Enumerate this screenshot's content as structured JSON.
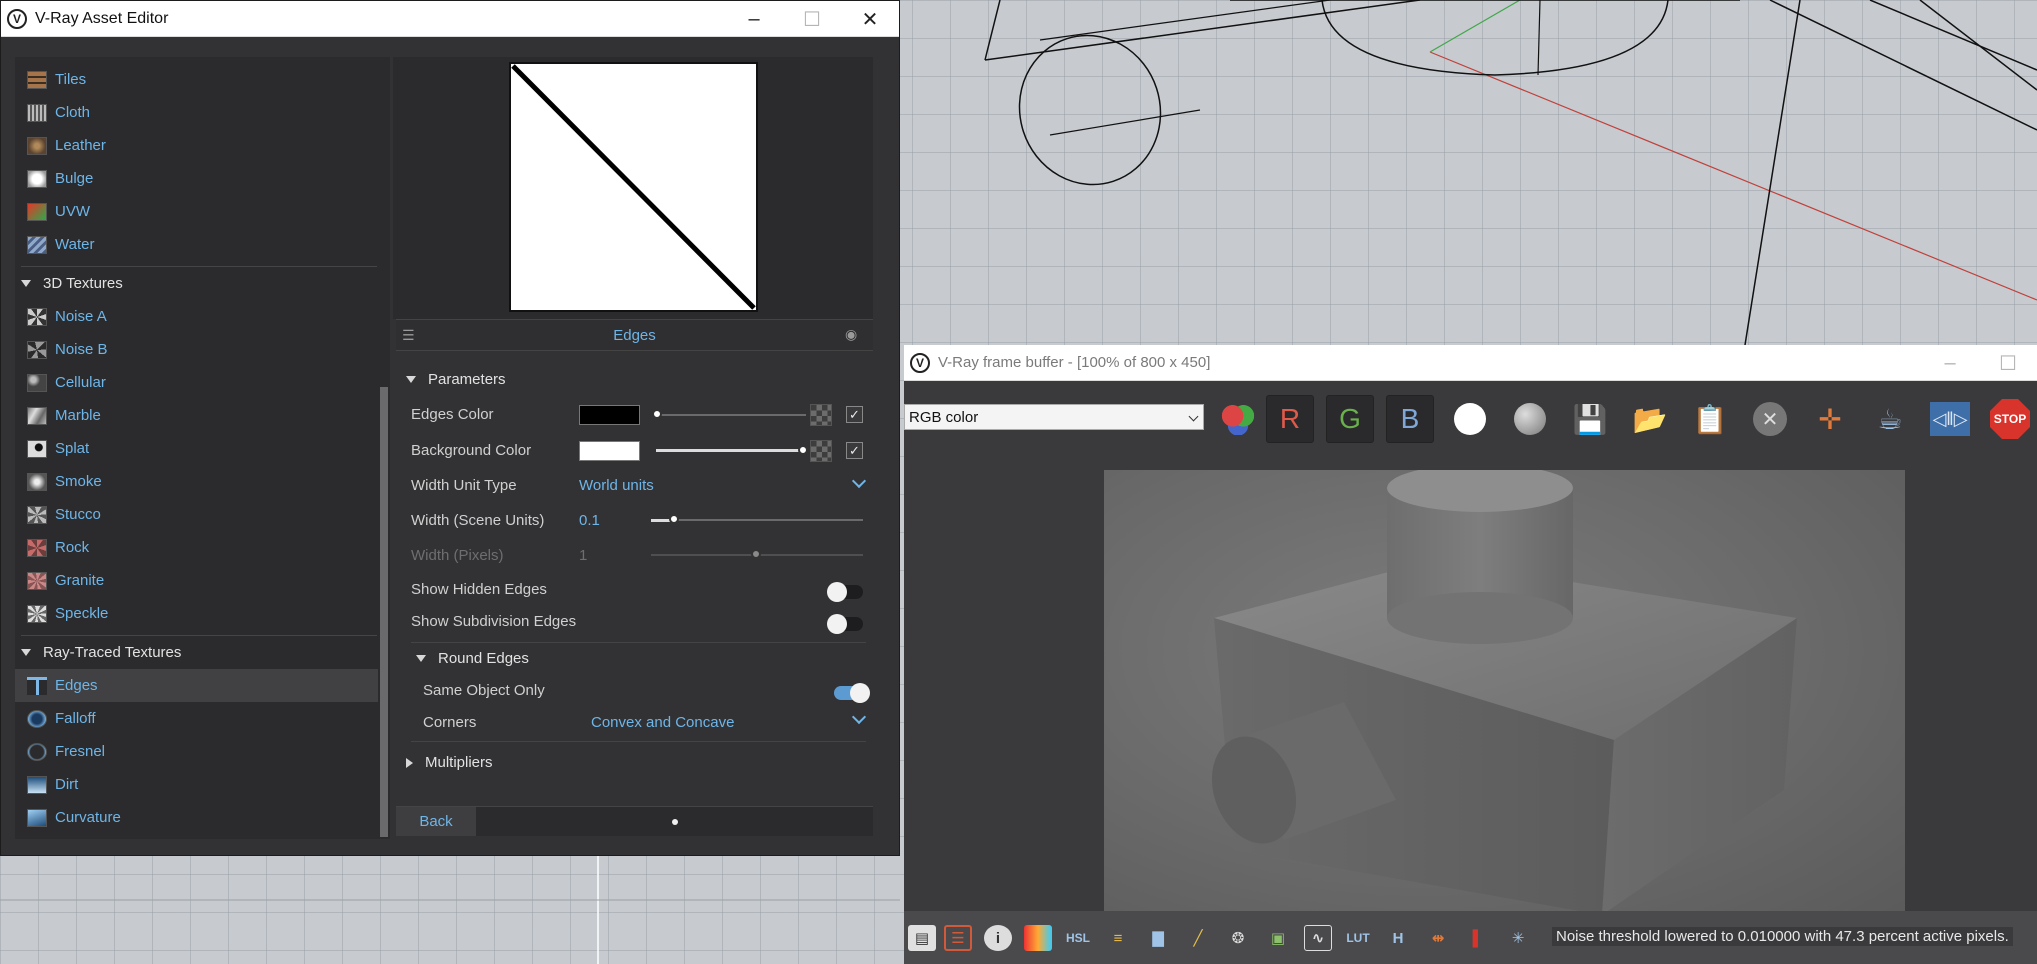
{
  "asset_editor": {
    "title": "V-Ray Asset Editor",
    "tree": {
      "top_items": [
        {
          "label": "Tiles",
          "icon": "tiles-icon"
        },
        {
          "label": "Cloth",
          "icon": "cloth-icon"
        },
        {
          "label": "Leather",
          "icon": "leather-icon"
        },
        {
          "label": "Bulge",
          "icon": "bulge-icon"
        },
        {
          "label": "UVW",
          "icon": "uvw-icon"
        },
        {
          "label": "Water",
          "icon": "water-icon"
        }
      ],
      "group_3d": {
        "label": "3D Textures",
        "items": [
          {
            "label": "Noise A",
            "icon": "noise-a-icon"
          },
          {
            "label": "Noise B",
            "icon": "noise-b-icon"
          },
          {
            "label": "Cellular",
            "icon": "cellular-icon"
          },
          {
            "label": "Marble",
            "icon": "marble-icon"
          },
          {
            "label": "Splat",
            "icon": "splat-icon"
          },
          {
            "label": "Smoke",
            "icon": "smoke-icon"
          },
          {
            "label": "Stucco",
            "icon": "stucco-icon"
          },
          {
            "label": "Rock",
            "icon": "rock-icon"
          },
          {
            "label": "Granite",
            "icon": "granite-icon"
          },
          {
            "label": "Speckle",
            "icon": "speckle-icon"
          }
        ]
      },
      "group_rt": {
        "label": "Ray-Traced Textures",
        "items": [
          {
            "label": "Edges",
            "icon": "edges-icon",
            "selected": true
          },
          {
            "label": "Falloff",
            "icon": "falloff-icon"
          },
          {
            "label": "Fresnel",
            "icon": "fresnel-icon"
          },
          {
            "label": "Dirt",
            "icon": "dirt-icon"
          },
          {
            "label": "Curvature",
            "icon": "curvature-icon"
          }
        ]
      }
    },
    "editor": {
      "name": "Edges",
      "parameters": {
        "title": "Parameters",
        "edges_color": {
          "label": "Edges Color",
          "color": "#000000",
          "slider": 0.0,
          "enabled": true
        },
        "background_color": {
          "label": "Background Color",
          "color": "#ffffff",
          "slider": 1.0,
          "enabled": true
        },
        "width_unit_type": {
          "label": "Width Unit Type",
          "value": "World units"
        },
        "width_scene_units": {
          "label": "Width (Scene Units)",
          "value": "0.1"
        },
        "width_pixels": {
          "label": "Width (Pixels)",
          "value": "1"
        },
        "show_hidden_edges": {
          "label": "Show Hidden Edges",
          "on": false
        },
        "show_subdivision_edges": {
          "label": "Show Subdivision Edges",
          "on": false
        }
      },
      "round_edges": {
        "title": "Round Edges",
        "same_object_only": {
          "label": "Same Object Only",
          "on": true
        },
        "corners": {
          "label": "Corners",
          "value": "Convex and Concave"
        }
      },
      "multipliers": {
        "title": "Multipliers"
      },
      "back_label": "Back"
    }
  },
  "frame_buffer": {
    "title": "V-Ray frame buffer - [100% of 800 x 450]",
    "channel_select": "RGB color",
    "channel_buttons": [
      "R",
      "G",
      "B"
    ],
    "status_text": "Noise threshold lowered to 0.010000 with 47.3 percent active pixels."
  },
  "colors": {
    "accent": "#6eb5e8",
    "panel_bg": "#323234",
    "tree_bg": "#2b2b2d",
    "stop_red": "#d9342b",
    "toggle_on": "#5c9bd1"
  }
}
